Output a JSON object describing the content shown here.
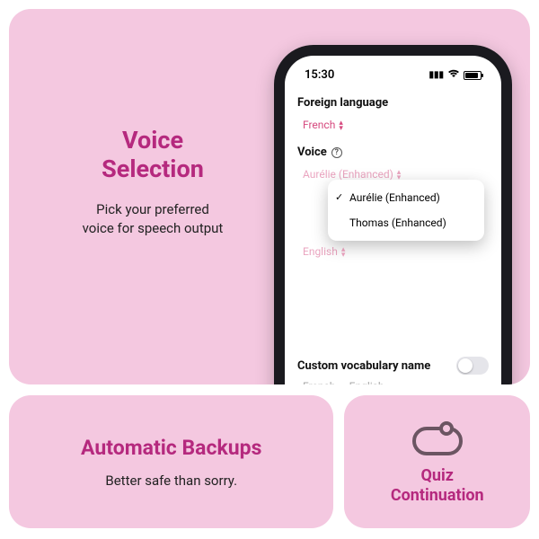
{
  "top": {
    "title_line1": "Voice",
    "title_line2": "Selection",
    "subtitle_line1": "Pick your preferred",
    "subtitle_line2": "voice for speech output"
  },
  "phone": {
    "time": "15:30",
    "foreign_label": "Foreign language",
    "foreign_value": "French",
    "voice_label": "Voice",
    "voice_value": "Aurélie (Enhanced)",
    "dropdown": {
      "options": [
        {
          "label": "Aurélie (Enhanced)",
          "checked": true
        },
        {
          "label": "Thomas (Enhanced)",
          "checked": false
        }
      ]
    },
    "second_lang": "English",
    "custom_label": "Custom vocabulary name",
    "custom_value": "French — English"
  },
  "backup": {
    "title": "Automatic Backups",
    "subtitle": "Better safe than sorry."
  },
  "quiz": {
    "title_line1": "Quiz",
    "title_line2": "Continuation"
  }
}
